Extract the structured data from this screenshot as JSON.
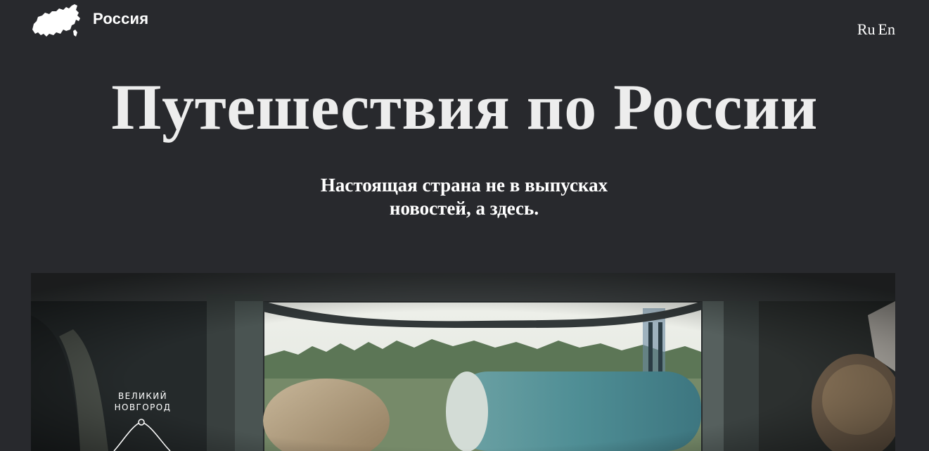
{
  "header": {
    "logo_icon": "russia-map-icon",
    "logo_text": "Россия",
    "languages": [
      "Ru",
      "En"
    ]
  },
  "hero": {
    "title": "Путешествия по России",
    "subtitle": "Настоящая страна не в выпусках новостей, а здесь."
  },
  "cover": {
    "city_label": "ВЕЛИКИЙ НОВГОРОД"
  },
  "colors": {
    "background": "#28292d",
    "text": "#ffffff"
  }
}
